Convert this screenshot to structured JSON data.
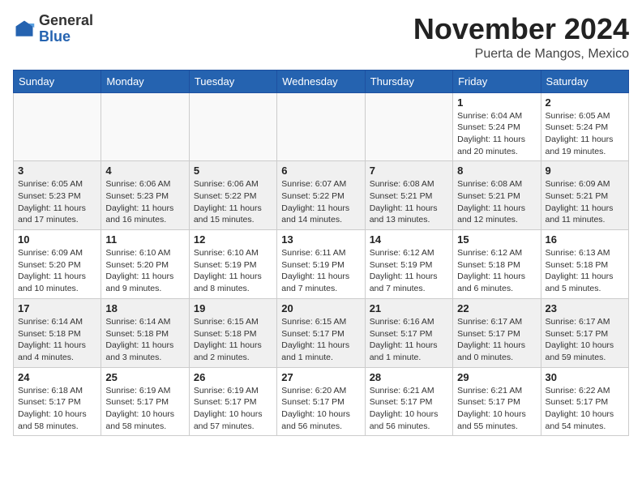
{
  "header": {
    "logo_general": "General",
    "logo_blue": "Blue",
    "month_title": "November 2024",
    "location": "Puerta de Mangos, Mexico"
  },
  "days_of_week": [
    "Sunday",
    "Monday",
    "Tuesday",
    "Wednesday",
    "Thursday",
    "Friday",
    "Saturday"
  ],
  "weeks": [
    {
      "shaded": false,
      "days": [
        {
          "num": "",
          "info": ""
        },
        {
          "num": "",
          "info": ""
        },
        {
          "num": "",
          "info": ""
        },
        {
          "num": "",
          "info": ""
        },
        {
          "num": "",
          "info": ""
        },
        {
          "num": "1",
          "info": "Sunrise: 6:04 AM\nSunset: 5:24 PM\nDaylight: 11 hours and 20 minutes."
        },
        {
          "num": "2",
          "info": "Sunrise: 6:05 AM\nSunset: 5:24 PM\nDaylight: 11 hours and 19 minutes."
        }
      ]
    },
    {
      "shaded": true,
      "days": [
        {
          "num": "3",
          "info": "Sunrise: 6:05 AM\nSunset: 5:23 PM\nDaylight: 11 hours and 17 minutes."
        },
        {
          "num": "4",
          "info": "Sunrise: 6:06 AM\nSunset: 5:23 PM\nDaylight: 11 hours and 16 minutes."
        },
        {
          "num": "5",
          "info": "Sunrise: 6:06 AM\nSunset: 5:22 PM\nDaylight: 11 hours and 15 minutes."
        },
        {
          "num": "6",
          "info": "Sunrise: 6:07 AM\nSunset: 5:22 PM\nDaylight: 11 hours and 14 minutes."
        },
        {
          "num": "7",
          "info": "Sunrise: 6:08 AM\nSunset: 5:21 PM\nDaylight: 11 hours and 13 minutes."
        },
        {
          "num": "8",
          "info": "Sunrise: 6:08 AM\nSunset: 5:21 PM\nDaylight: 11 hours and 12 minutes."
        },
        {
          "num": "9",
          "info": "Sunrise: 6:09 AM\nSunset: 5:21 PM\nDaylight: 11 hours and 11 minutes."
        }
      ]
    },
    {
      "shaded": false,
      "days": [
        {
          "num": "10",
          "info": "Sunrise: 6:09 AM\nSunset: 5:20 PM\nDaylight: 11 hours and 10 minutes."
        },
        {
          "num": "11",
          "info": "Sunrise: 6:10 AM\nSunset: 5:20 PM\nDaylight: 11 hours and 9 minutes."
        },
        {
          "num": "12",
          "info": "Sunrise: 6:10 AM\nSunset: 5:19 PM\nDaylight: 11 hours and 8 minutes."
        },
        {
          "num": "13",
          "info": "Sunrise: 6:11 AM\nSunset: 5:19 PM\nDaylight: 11 hours and 7 minutes."
        },
        {
          "num": "14",
          "info": "Sunrise: 6:12 AM\nSunset: 5:19 PM\nDaylight: 11 hours and 7 minutes."
        },
        {
          "num": "15",
          "info": "Sunrise: 6:12 AM\nSunset: 5:18 PM\nDaylight: 11 hours and 6 minutes."
        },
        {
          "num": "16",
          "info": "Sunrise: 6:13 AM\nSunset: 5:18 PM\nDaylight: 11 hours and 5 minutes."
        }
      ]
    },
    {
      "shaded": true,
      "days": [
        {
          "num": "17",
          "info": "Sunrise: 6:14 AM\nSunset: 5:18 PM\nDaylight: 11 hours and 4 minutes."
        },
        {
          "num": "18",
          "info": "Sunrise: 6:14 AM\nSunset: 5:18 PM\nDaylight: 11 hours and 3 minutes."
        },
        {
          "num": "19",
          "info": "Sunrise: 6:15 AM\nSunset: 5:18 PM\nDaylight: 11 hours and 2 minutes."
        },
        {
          "num": "20",
          "info": "Sunrise: 6:15 AM\nSunset: 5:17 PM\nDaylight: 11 hours and 1 minute."
        },
        {
          "num": "21",
          "info": "Sunrise: 6:16 AM\nSunset: 5:17 PM\nDaylight: 11 hours and 1 minute."
        },
        {
          "num": "22",
          "info": "Sunrise: 6:17 AM\nSunset: 5:17 PM\nDaylight: 11 hours and 0 minutes."
        },
        {
          "num": "23",
          "info": "Sunrise: 6:17 AM\nSunset: 5:17 PM\nDaylight: 10 hours and 59 minutes."
        }
      ]
    },
    {
      "shaded": false,
      "days": [
        {
          "num": "24",
          "info": "Sunrise: 6:18 AM\nSunset: 5:17 PM\nDaylight: 10 hours and 58 minutes."
        },
        {
          "num": "25",
          "info": "Sunrise: 6:19 AM\nSunset: 5:17 PM\nDaylight: 10 hours and 58 minutes."
        },
        {
          "num": "26",
          "info": "Sunrise: 6:19 AM\nSunset: 5:17 PM\nDaylight: 10 hours and 57 minutes."
        },
        {
          "num": "27",
          "info": "Sunrise: 6:20 AM\nSunset: 5:17 PM\nDaylight: 10 hours and 56 minutes."
        },
        {
          "num": "28",
          "info": "Sunrise: 6:21 AM\nSunset: 5:17 PM\nDaylight: 10 hours and 56 minutes."
        },
        {
          "num": "29",
          "info": "Sunrise: 6:21 AM\nSunset: 5:17 PM\nDaylight: 10 hours and 55 minutes."
        },
        {
          "num": "30",
          "info": "Sunrise: 6:22 AM\nSunset: 5:17 PM\nDaylight: 10 hours and 54 minutes."
        }
      ]
    }
  ]
}
